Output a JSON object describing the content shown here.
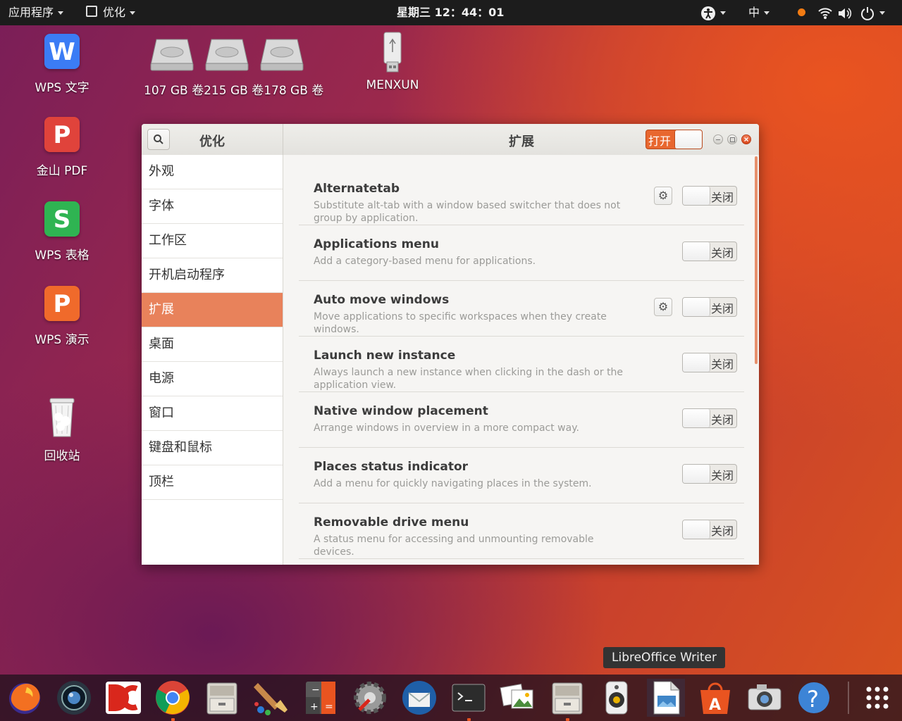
{
  "topbar": {
    "apps_menu": "应用程序",
    "active_app": "优化",
    "clock": "星期三 12：44：01",
    "input_method": "中"
  },
  "desktop": {
    "icons": [
      {
        "label": "WPS 文字",
        "icon": "wps-writer-icon",
        "color": "#3b7cf5",
        "glyph": "W"
      },
      {
        "label": "金山 PDF",
        "icon": "wps-pdf-icon",
        "color": "#e0433b",
        "glyph": "P"
      },
      {
        "label": "WPS 表格",
        "icon": "wps-spreadsheet-icon",
        "color": "#2fb452",
        "glyph": "S"
      },
      {
        "label": "WPS 演示",
        "icon": "wps-presentation-icon",
        "color": "#f06a2b",
        "glyph": "P"
      },
      {
        "label": "回收站",
        "icon": "trash-icon"
      }
    ],
    "drives": [
      {
        "label": "107 GB 卷"
      },
      {
        "label": "215 GB 卷"
      },
      {
        "label": "178 GB 卷"
      }
    ],
    "usb": {
      "label": "MENXUN"
    }
  },
  "window": {
    "sidebar_title": "优化",
    "page_title": "扩展",
    "master_toggle_label": "打开",
    "sidebar_items": [
      "外观",
      "字体",
      "工作区",
      "开机启动程序",
      "扩展",
      "桌面",
      "电源",
      "窗口",
      "键盘和鼠标",
      "顶栏"
    ],
    "active_index": 4,
    "extensions": [
      {
        "name": "Alternatetab",
        "desc": "Substitute alt-tab with a window based switcher that does not group by application.",
        "has_settings": true,
        "state": "关闭"
      },
      {
        "name": "Applications menu",
        "desc": "Add a category-based menu for applications.",
        "has_settings": false,
        "state": "关闭"
      },
      {
        "name": "Auto move windows",
        "desc": "Move applications to specific workspaces when they create windows.",
        "has_settings": true,
        "state": "关闭"
      },
      {
        "name": "Launch new instance",
        "desc": "Always launch a new instance when clicking in the dash or the application view.",
        "has_settings": false,
        "state": "关闭"
      },
      {
        "name": "Native window placement",
        "desc": "Arrange windows in overview in a more compact way.",
        "has_settings": false,
        "state": "关闭"
      },
      {
        "name": "Places status indicator",
        "desc": "Add a menu for quickly navigating places in the system.",
        "has_settings": false,
        "state": "关闭"
      },
      {
        "name": "Removable drive menu",
        "desc": "A status menu for accessing and unmounting removable devices.",
        "has_settings": false,
        "state": "关闭"
      }
    ]
  },
  "dock": {
    "tooltip": "LibreOffice Writer",
    "apps": [
      {
        "name": "firefox-icon",
        "running": false
      },
      {
        "name": "camera-lens-icon",
        "running": false
      },
      {
        "name": "dc-app-icon",
        "running": false
      },
      {
        "name": "chrome-icon",
        "running": true
      },
      {
        "name": "file-cabinet-icon",
        "running": false
      },
      {
        "name": "paint-brush-icon",
        "running": false
      },
      {
        "name": "calculator-icon",
        "running": false
      },
      {
        "name": "settings-gear-icon",
        "running": false
      },
      {
        "name": "thunderbird-icon",
        "running": false
      },
      {
        "name": "terminal-icon",
        "running": true
      },
      {
        "name": "image-viewer-icon",
        "running": false
      },
      {
        "name": "file-cabinet-icon",
        "running": true
      },
      {
        "name": "speaker-icon",
        "running": false
      },
      {
        "name": "libreoffice-writer-icon",
        "running": false
      },
      {
        "name": "software-center-icon",
        "running": false
      },
      {
        "name": "photo-camera-icon",
        "running": false
      },
      {
        "name": "help-icon",
        "running": false
      },
      {
        "name": "app-grid-icon",
        "running": false
      }
    ]
  }
}
